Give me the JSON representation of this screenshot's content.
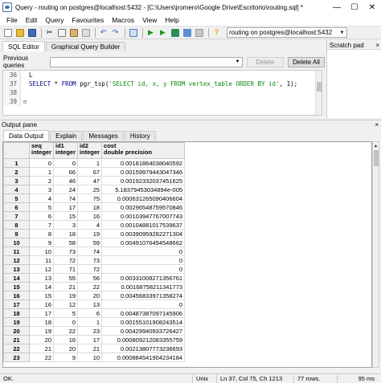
{
  "window": {
    "title": "Query - routing on postgres@localhost:5432 - [C:\\Users\\jromero\\Google Drive\\Escritorio\\routing.sql] *",
    "minimize": "—",
    "maximize": "☐",
    "close": "✕"
  },
  "menu": [
    "File",
    "Edit",
    "Query",
    "Favourites",
    "Macros",
    "View",
    "Help"
  ],
  "toolbar": {
    "connection": "routing on postgres@localhost:5432"
  },
  "editor": {
    "tabs": [
      "SQL Editor",
      "Graphical Query Builder"
    ],
    "previous_queries_label": "Previous queries",
    "previous_queries_value": "",
    "delete_label": "Delete",
    "delete_all_label": "Delete All",
    "lines": [
      {
        "num": "36",
        "fold": "",
        "text": "L"
      },
      {
        "num": "37",
        "fold": "",
        "text": "SELECT * FROM pgr_tsp('SELECT id, x, y FROM vertex_table ORDER BY id', 1);"
      },
      {
        "num": "38",
        "fold": "",
        "text": ""
      },
      {
        "num": "39",
        "fold": "⊟",
        "text": ""
      }
    ]
  },
  "scratch_pad": {
    "title": "Scratch pad",
    "close": "×"
  },
  "output": {
    "pane_title": "Output pane",
    "close": "×",
    "tabs": [
      "Data Output",
      "Explain",
      "Messages",
      "History"
    ],
    "columns": [
      {
        "name": "seq",
        "type": "integer"
      },
      {
        "name": "id1",
        "type": "integer"
      },
      {
        "name": "id2",
        "type": "integer"
      },
      {
        "name": "cost",
        "type": "double precision"
      }
    ],
    "rows": [
      [
        "1",
        "0",
        "0",
        "1",
        "0.00181864038040592"
      ],
      [
        "2",
        "1",
        "66",
        "67",
        "0.00159979443047346"
      ],
      [
        "3",
        "2",
        "46",
        "47",
        "0.00192332037451625"
      ],
      [
        "4",
        "3",
        "24",
        "25",
        "5.18379453034894e-005"
      ],
      [
        "5",
        "4",
        "74",
        "75",
        "0.000631265090406604"
      ],
      [
        "6",
        "5",
        "17",
        "18",
        "0.00296548759570846"
      ],
      [
        "7",
        "6",
        "15",
        "16",
        "0.00103947767007743"
      ],
      [
        "8",
        "7",
        "3",
        "4",
        "0.00104881017539637"
      ],
      [
        "9",
        "8",
        "18",
        "19",
        "0.00390959282271304"
      ],
      [
        "10",
        "9",
        "58",
        "59",
        "0.00491076494548662"
      ],
      [
        "11",
        "10",
        "73",
        "74",
        "0"
      ],
      [
        "12",
        "11",
        "72",
        "73",
        "0"
      ],
      [
        "13",
        "12",
        "71",
        "72",
        "0"
      ],
      [
        "14",
        "13",
        "55",
        "56",
        "0.00331008271356761"
      ],
      [
        "15",
        "14",
        "21",
        "22",
        "0.00168758211341773"
      ],
      [
        "16",
        "15",
        "19",
        "20",
        "0.00456833971358274"
      ],
      [
        "17",
        "16",
        "12",
        "13",
        "0"
      ],
      [
        "18",
        "17",
        "5",
        "6",
        "0.00487387097145906"
      ],
      [
        "19",
        "18",
        "0",
        "1",
        "0.00155101908243514"
      ],
      [
        "20",
        "19",
        "22",
        "23",
        "0.00429940933726427"
      ],
      [
        "21",
        "20",
        "16",
        "17",
        "0.000809212083355759"
      ],
      [
        "22",
        "21",
        "20",
        "21",
        "0.00213807773236693"
      ],
      [
        "23",
        "22",
        "9",
        "10",
        "0.000884541904234184"
      ]
    ]
  },
  "status": {
    "state": "OK.",
    "encoding": "Unix",
    "position": "Ln 37, Col 75, Ch 1213",
    "rows": "77 rows.",
    "time": "95 ms"
  }
}
